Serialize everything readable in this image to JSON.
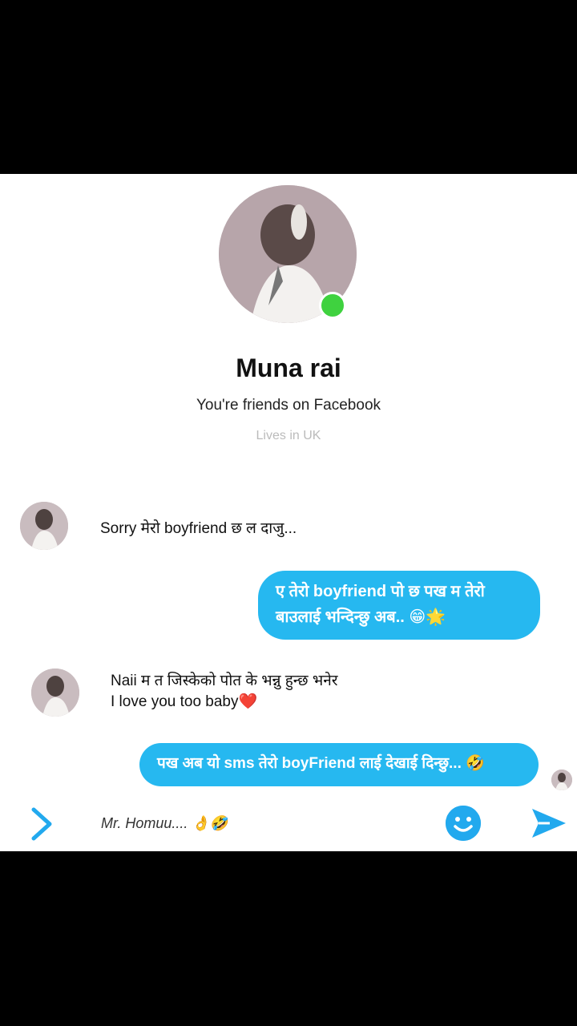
{
  "profile": {
    "name": "Muna rai",
    "friends_text": "You're friends on Facebook",
    "lives_text": "Lives in UK",
    "online": true
  },
  "messages": [
    {
      "direction": "in",
      "text": "Sorry मेरो boyfriend छ ल दाजु..."
    },
    {
      "direction": "out",
      "line1": "ए तेरो  boyfriend  पो छ  पख म तेरो",
      "line2": "बाउलाई  भन्दिन्छु  अब.. 😁🌟"
    },
    {
      "direction": "in",
      "line1": "Naii म त जिस्केको पोत के भन्नु हुन्छ भनेर",
      "line2": "I love you too baby❤️"
    },
    {
      "direction": "out",
      "text": "पख अब  यो sms तेरो boyFriend लाई देखाई दिन्छु... 🤣"
    }
  ],
  "composer": {
    "text": "Mr. Homuu....",
    "emojis": "👌🤣"
  },
  "colors": {
    "accent": "#26b8f0",
    "online": "#3fd23f",
    "background": "#ffffff",
    "letterbox": "#000000"
  },
  "icons": [
    "chevron-right-icon",
    "emoji-icon",
    "send-icon"
  ]
}
